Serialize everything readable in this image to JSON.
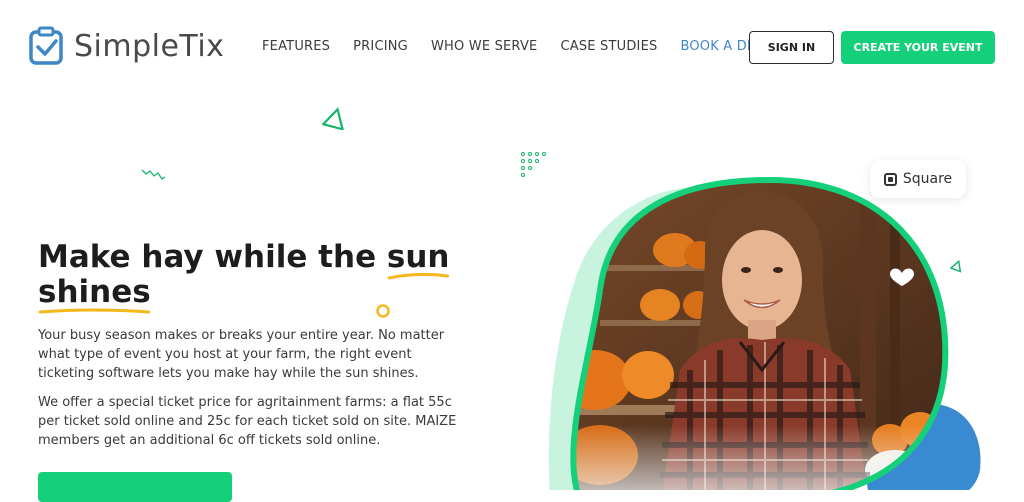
{
  "header": {
    "brand": "SimpleTix",
    "nav": [
      "FEATURES",
      "PRICING",
      "WHO WE SERVE",
      "CASE STUDIES",
      "BOOK A DEMO"
    ],
    "sign_in": "SIGN IN",
    "create_event": "CREATE YOUR EVENT"
  },
  "hero": {
    "title_part1": "Make hay while the ",
    "title_highlight1": "sun",
    "title_highlight2": "shines",
    "paragraph1": "Your busy season makes or breaks your entire year. No matter what type of event you host at your farm, the right event ticketing software lets you make hay while the sun shines.",
    "paragraph2": "We offer a special ticket price for agritainment farms: a flat 55c per ticket sold online and 25c for each ticket sold on site. MAIZE members get an additional 6c off tickets sold online."
  },
  "badge": {
    "label": "Square"
  },
  "colors": {
    "accent": "#15d07a",
    "link": "#3f86c7",
    "underline": "#f5b81b",
    "blob_light": "#c7f3df",
    "blob_blue": "#3a8ad1"
  }
}
